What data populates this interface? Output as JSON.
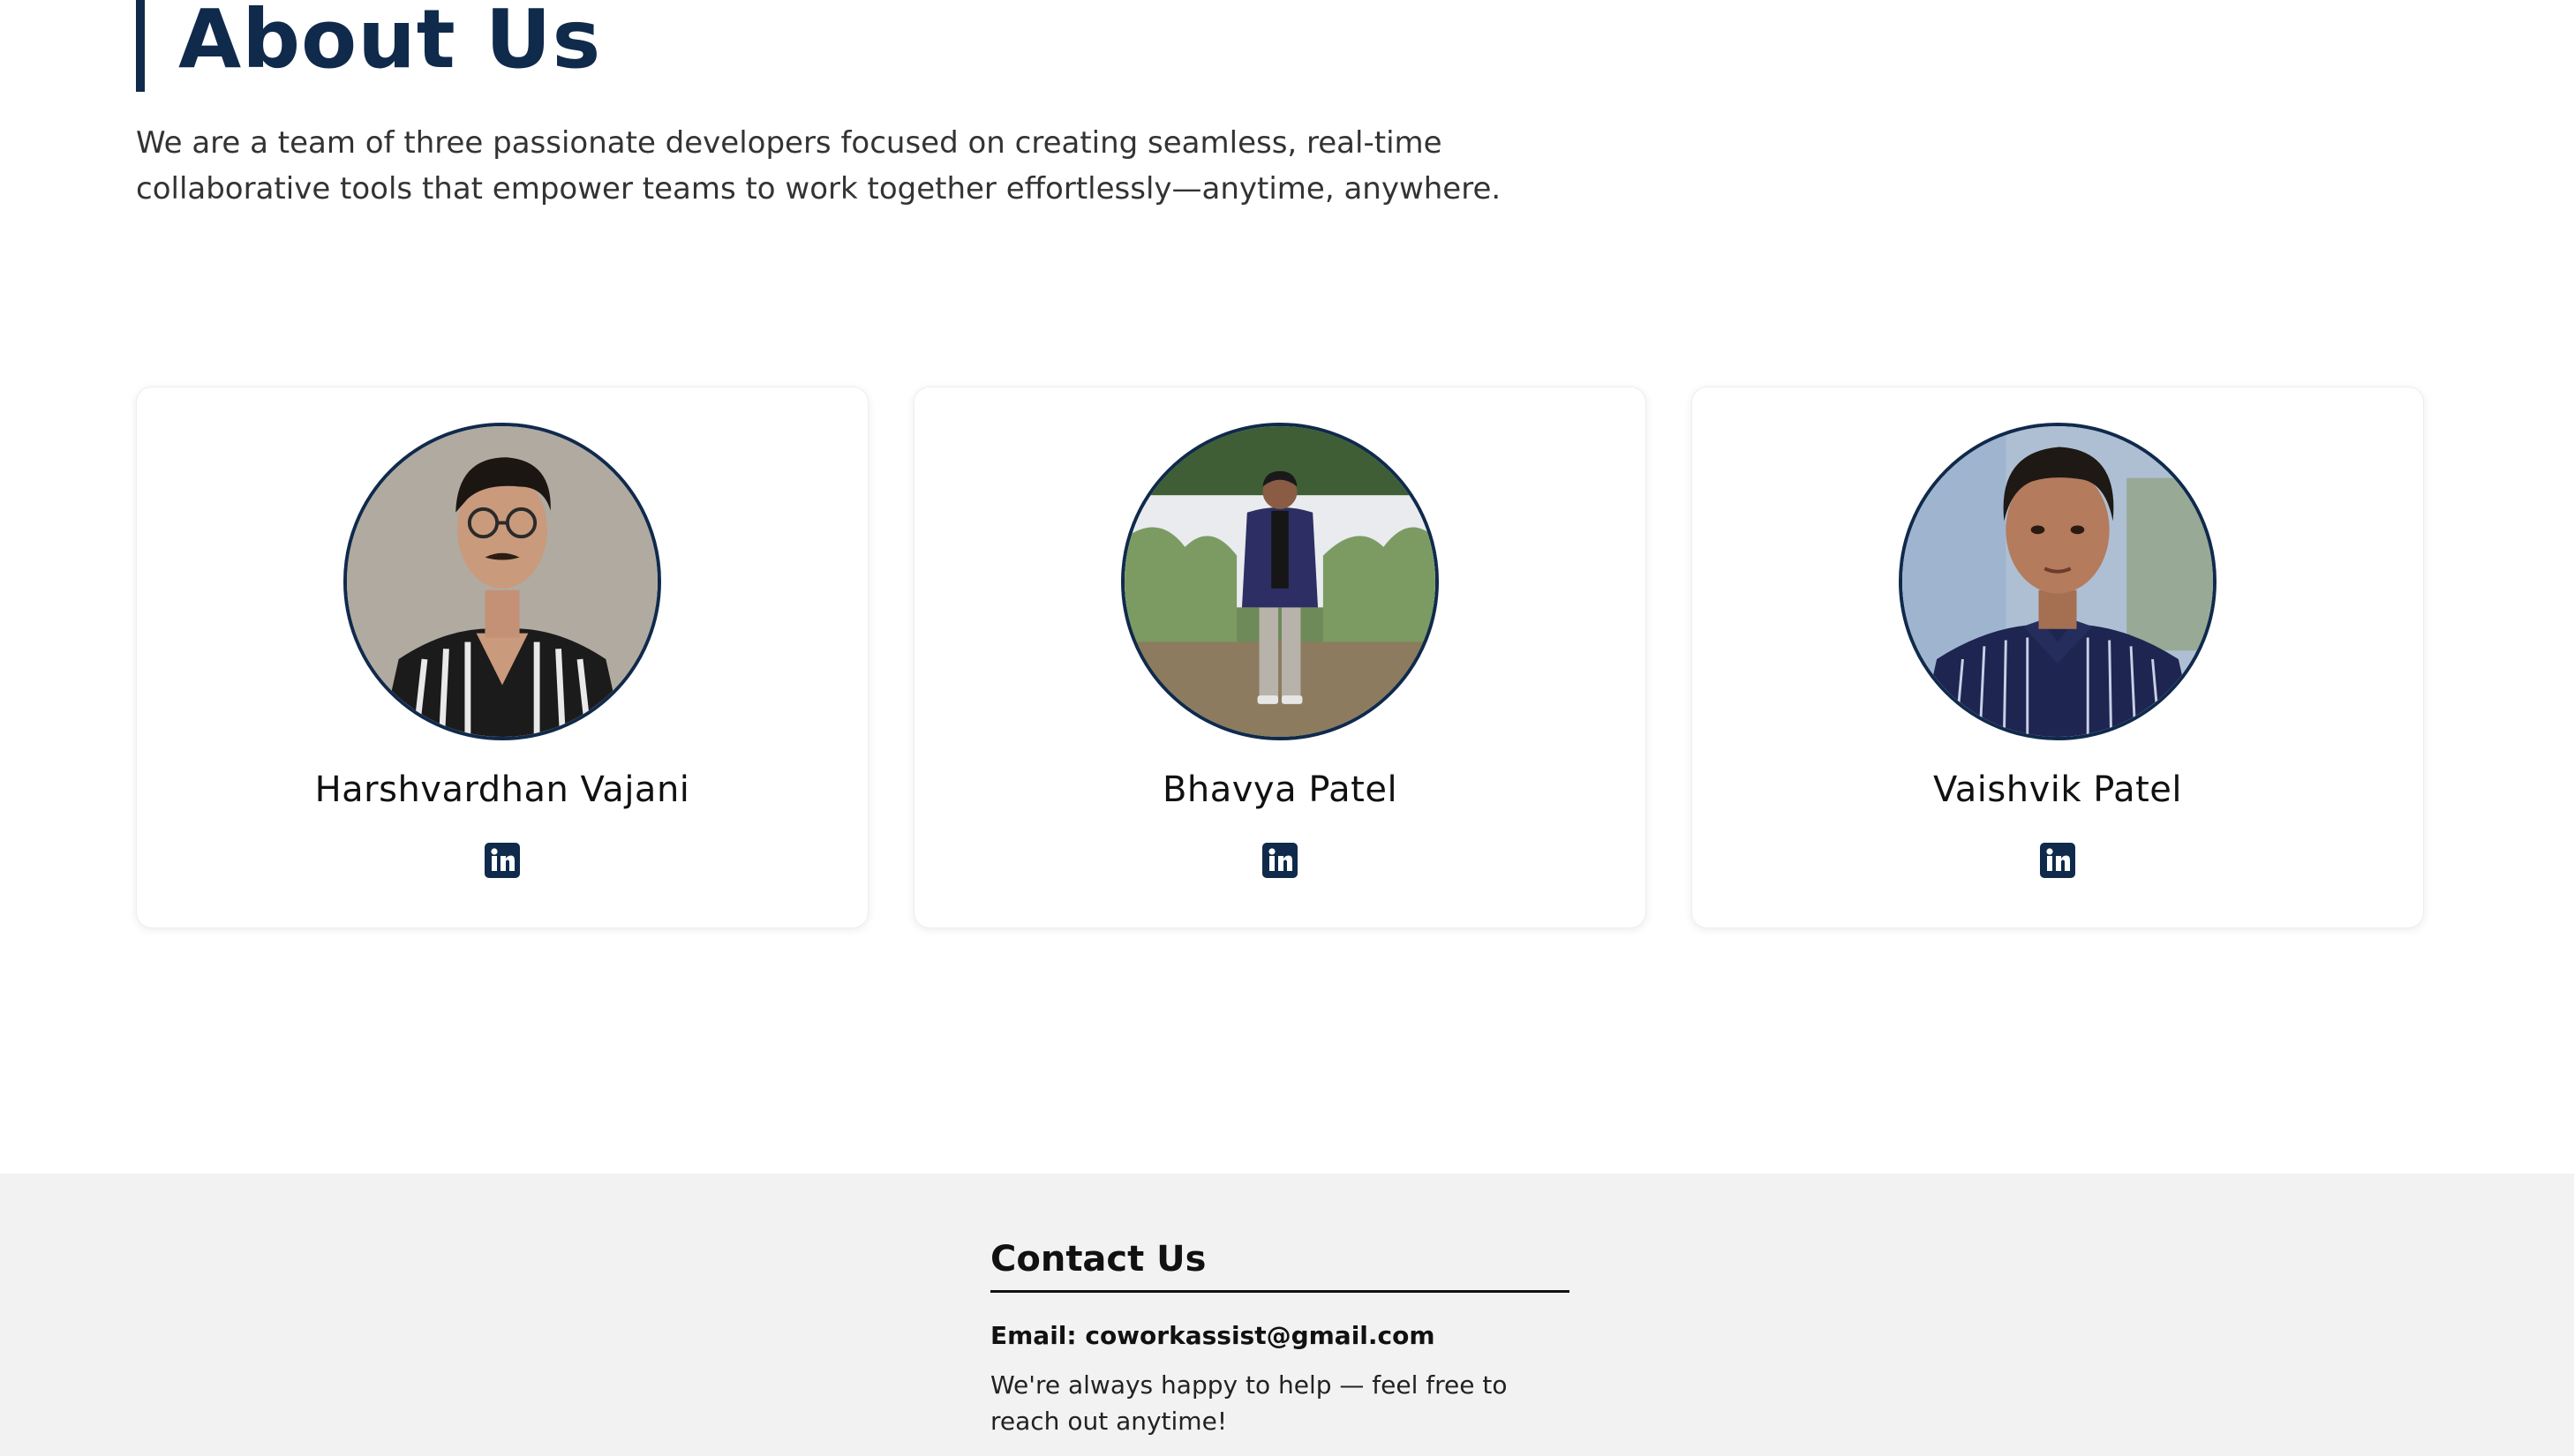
{
  "about": {
    "title": "About Us",
    "description": "We are a team of three passionate developers focused on creating seamless, real-time collaborative tools that empower teams to work together effortlessly—anytime, anywhere."
  },
  "team": {
    "members": [
      {
        "name": "Harshvardhan Vajani",
        "icon": "linkedin-icon"
      },
      {
        "name": "Bhavya Patel",
        "icon": "linkedin-icon"
      },
      {
        "name": "Vaishvik Patel",
        "icon": "linkedin-icon"
      }
    ]
  },
  "footer": {
    "contact_title": "Contact Us",
    "email_label": "Email:",
    "email": "coworkassist@gmail.com",
    "note": "We're always happy to help — feel free to reach out anytime!"
  },
  "colors": {
    "brand_navy": "#102a4c",
    "footer_bg": "#f2f2f2",
    "text_dark": "#111111"
  }
}
